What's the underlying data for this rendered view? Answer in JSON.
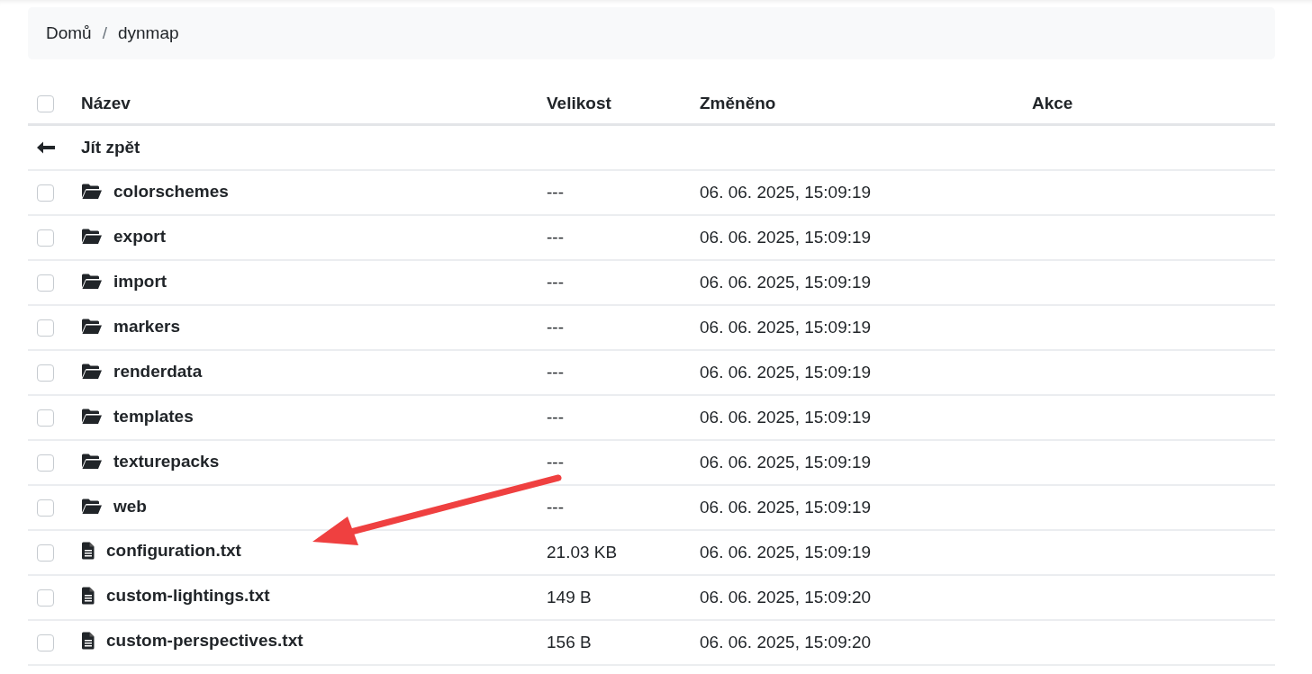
{
  "breadcrumb": {
    "items": [
      "Domů",
      "dynmap"
    ],
    "separator": "/"
  },
  "table": {
    "columns": [
      "Název",
      "Velikost",
      "Změněno",
      "Akce"
    ],
    "header_checked": false,
    "rows": [
      {
        "kind": "back",
        "name": "Jít zpět"
      },
      {
        "kind": "folder",
        "name": "colorschemes",
        "size": "---",
        "modified": "06. 06. 2025, 15:09:19",
        "checked": false
      },
      {
        "kind": "folder",
        "name": "export",
        "size": "---",
        "modified": "06. 06. 2025, 15:09:19",
        "checked": false
      },
      {
        "kind": "folder",
        "name": "import",
        "size": "---",
        "modified": "06. 06. 2025, 15:09:19",
        "checked": false
      },
      {
        "kind": "folder",
        "name": "markers",
        "size": "---",
        "modified": "06. 06. 2025, 15:09:19",
        "checked": false
      },
      {
        "kind": "folder",
        "name": "renderdata",
        "size": "---",
        "modified": "06. 06. 2025, 15:09:19",
        "checked": false
      },
      {
        "kind": "folder",
        "name": "templates",
        "size": "---",
        "modified": "06. 06. 2025, 15:09:19",
        "checked": false
      },
      {
        "kind": "folder",
        "name": "texturepacks",
        "size": "---",
        "modified": "06. 06. 2025, 15:09:19",
        "checked": false
      },
      {
        "kind": "folder",
        "name": "web",
        "size": "---",
        "modified": "06. 06. 2025, 15:09:19",
        "checked": false
      },
      {
        "kind": "file",
        "name": "configuration.txt",
        "size": "21.03 KB",
        "modified": "06. 06. 2025, 15:09:19",
        "checked": false
      },
      {
        "kind": "file",
        "name": "custom-lightings.txt",
        "size": "149 B",
        "modified": "06. 06. 2025, 15:09:20",
        "checked": false
      },
      {
        "kind": "file",
        "name": "custom-perspectives.txt",
        "size": "156 B",
        "modified": "06. 06. 2025, 15:09:20",
        "checked": false
      }
    ]
  }
}
